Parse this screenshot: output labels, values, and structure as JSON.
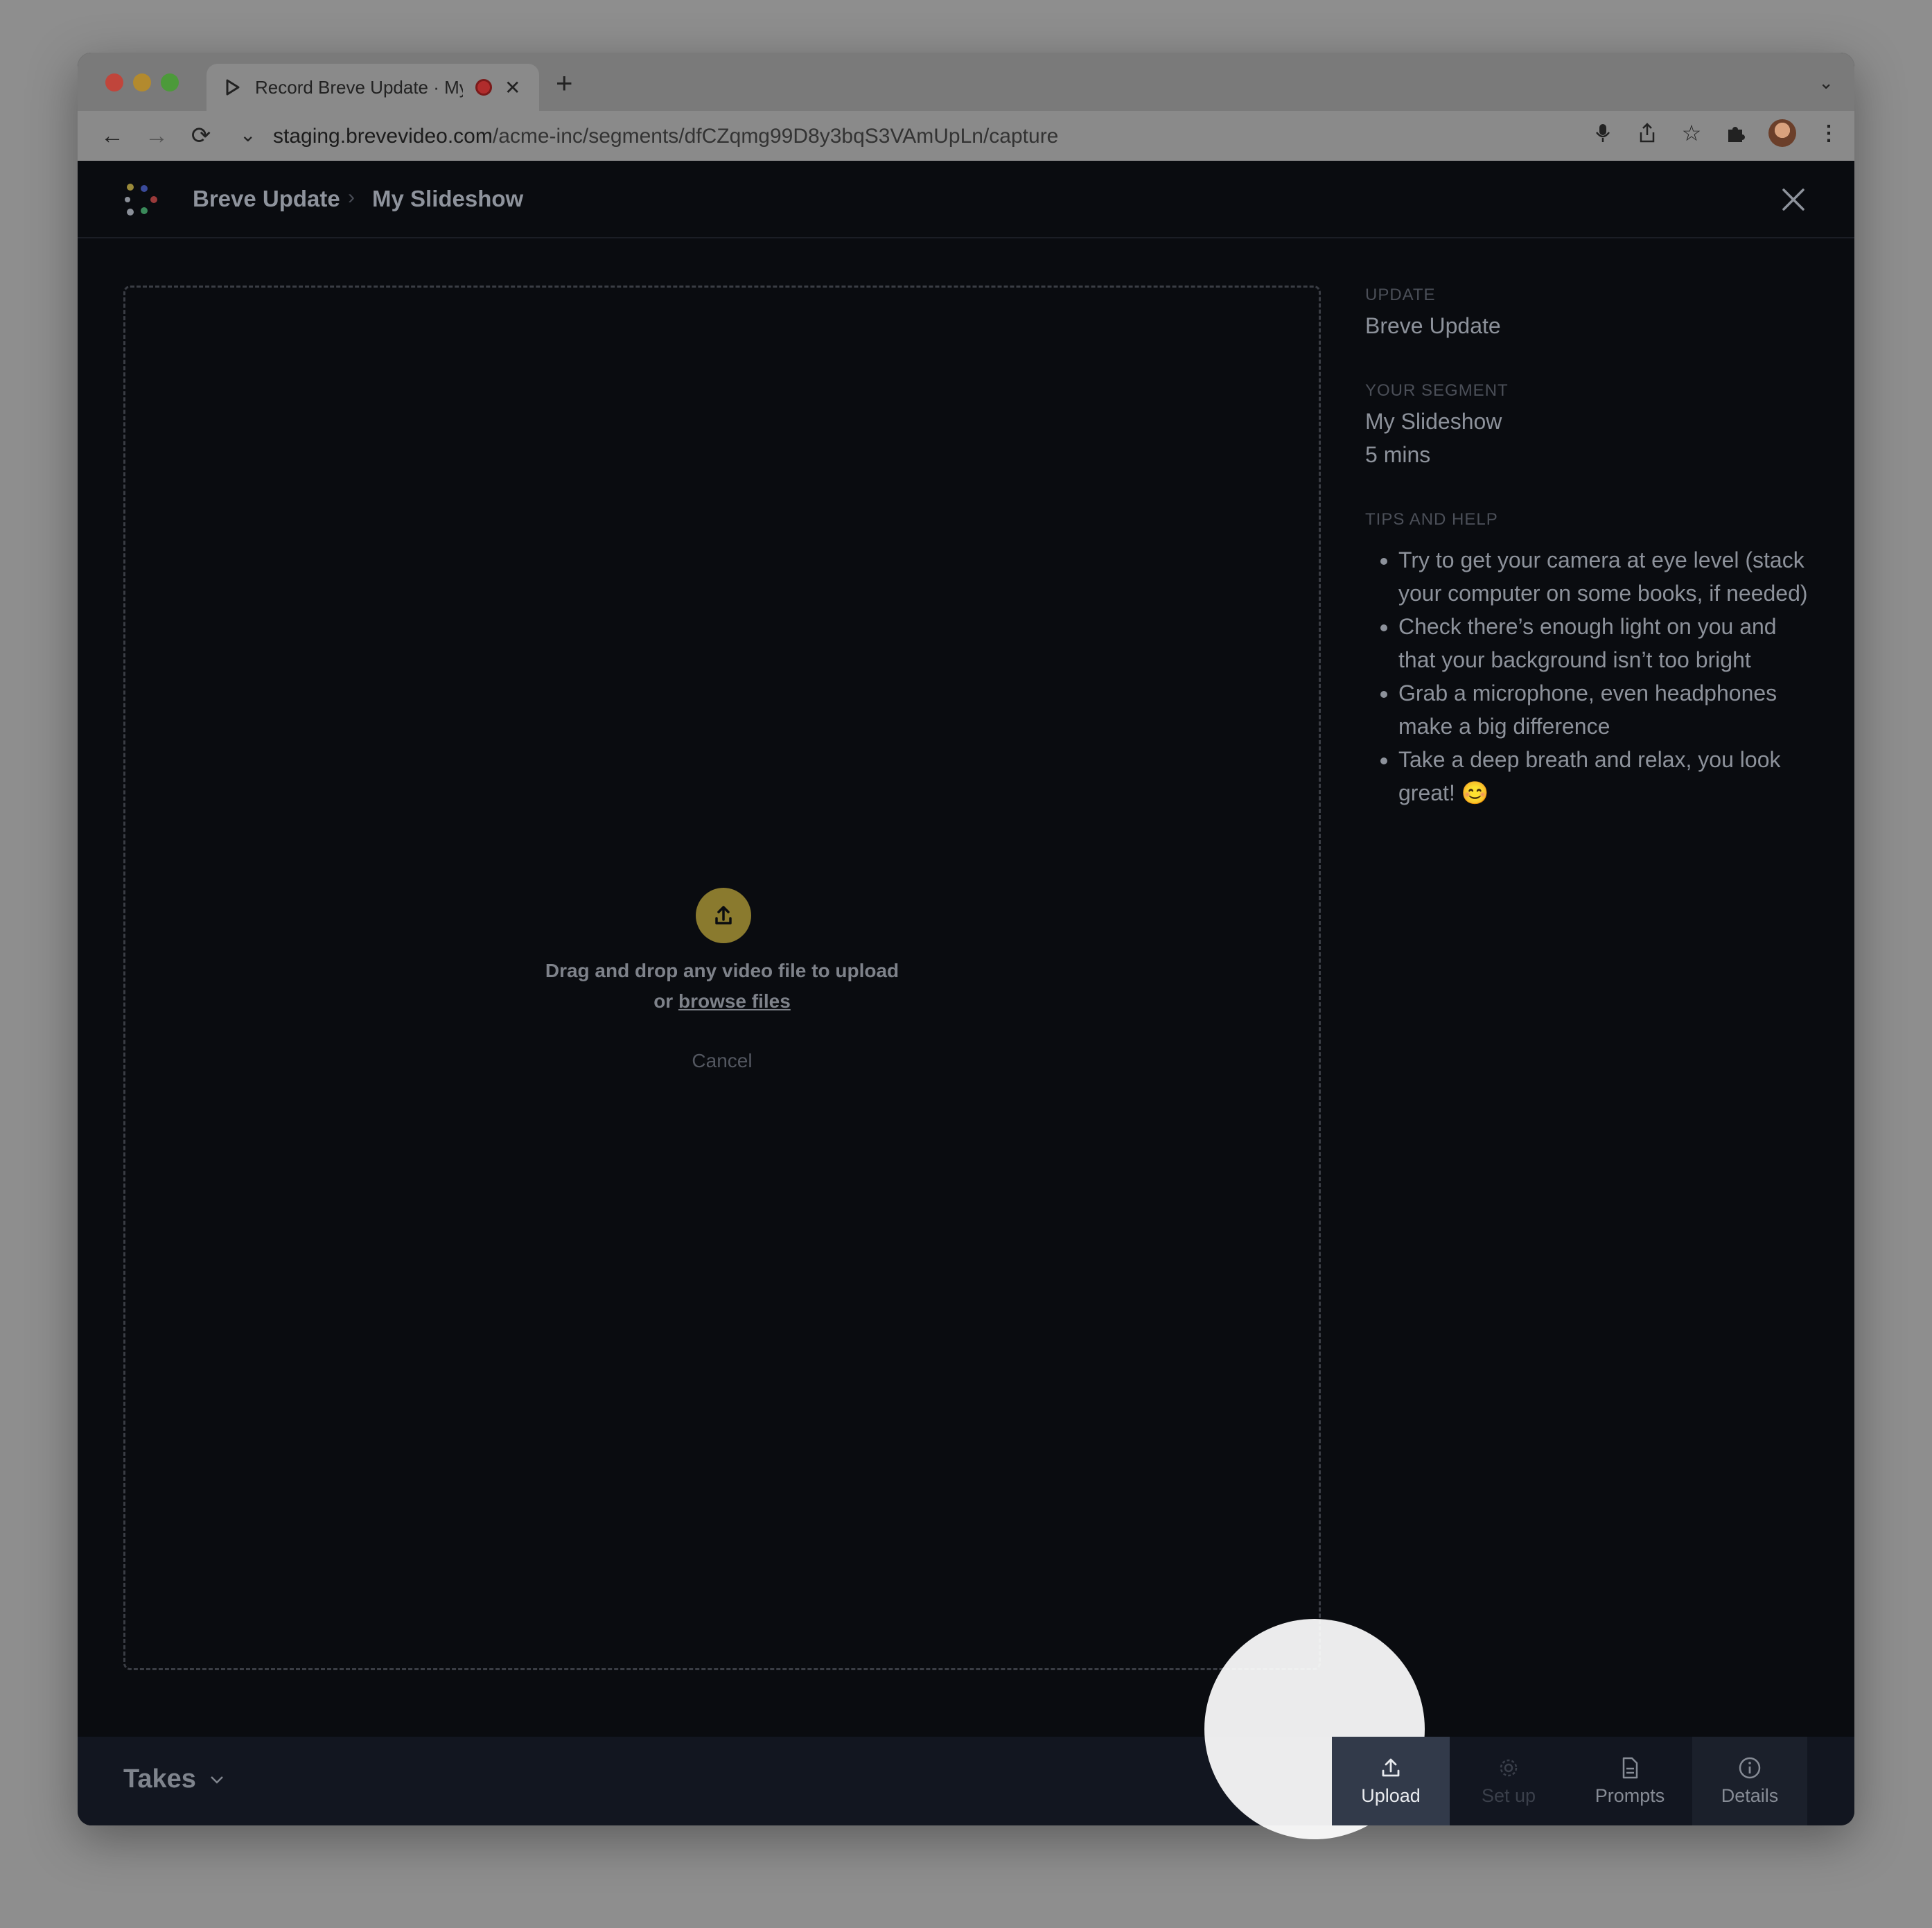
{
  "browser": {
    "tab_title": "Record Breve Update · My Slideshow",
    "new_tab_label": "+",
    "url_host": "staging.brevevideo.com",
    "url_path": "/acme-inc/segments/dfCZqmg99D8y3bqS3VAmUpLn/capture"
  },
  "header": {
    "breadcrumb_update": "Breve Update",
    "breadcrumb_segment": "My Slideshow",
    "separator": "›"
  },
  "dropzone": {
    "line1": "Drag and drop any video file to upload",
    "or": "or ",
    "browse": "browse files",
    "cancel": "Cancel"
  },
  "info": {
    "update_label": "UPDATE",
    "update_value": "Breve Update",
    "segment_label": "YOUR SEGMENT",
    "segment_value": "My Slideshow",
    "segment_duration": "5 mins",
    "tips_label": "TIPS AND HELP",
    "tips": [
      "Try to get your camera at eye level (stack your computer on some books, if needed)",
      "Check there’s enough light on you and that your background isn’t too bright",
      "Grab a microphone, even headphones make a big difference",
      "Take a deep breath and relax, you look great! 😊"
    ]
  },
  "bottom": {
    "takes_label": "Takes",
    "tabs": {
      "upload": "Upload",
      "setup": "Set up",
      "prompts": "Prompts",
      "details": "Details"
    }
  },
  "colors": {
    "background": "#0a0c10",
    "accent_upload": "#8a7a2e",
    "active_tab": "#323a4a"
  }
}
